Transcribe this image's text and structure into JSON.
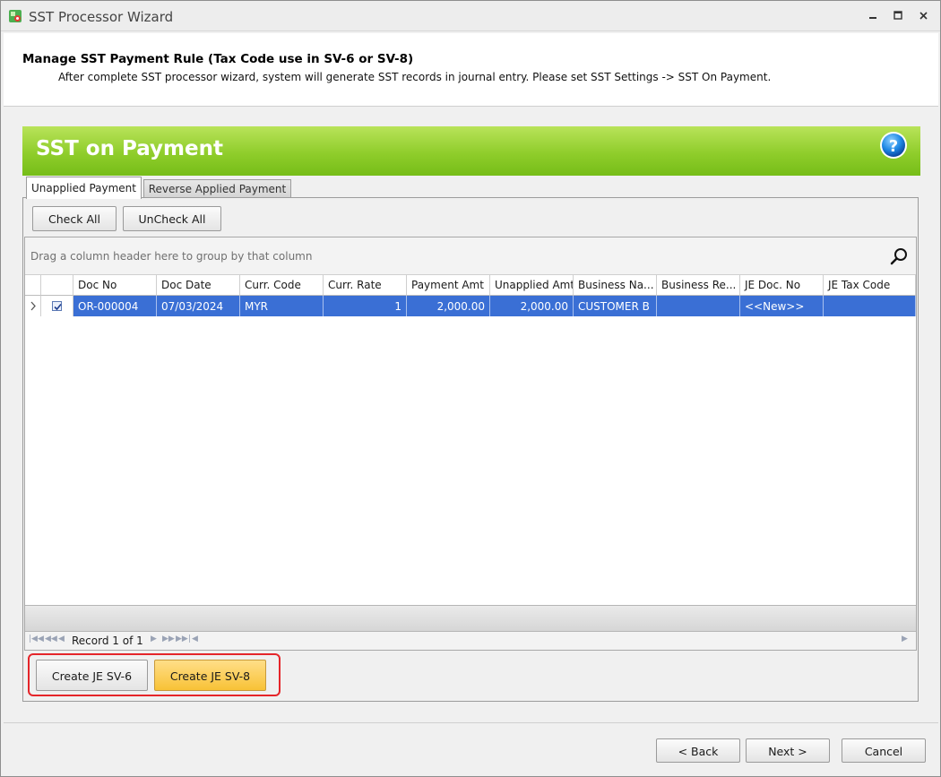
{
  "window": {
    "title": "SST Processor Wizard"
  },
  "header": {
    "title": "Manage SST Payment Rule (Tax Code use in SV-6 or SV-8)",
    "description": "After complete SST processor wizard, system will generate SST records in journal entry. Please set SST Settings -> SST On Payment."
  },
  "banner": {
    "title": "SST on Payment"
  },
  "tabs": [
    {
      "label": "Unapplied Payment",
      "active": true
    },
    {
      "label": "Reverse Applied Payment",
      "active": false
    }
  ],
  "toolbar": {
    "check_all": "Check All",
    "uncheck_all": "UnCheck All"
  },
  "grid": {
    "group_hint": "Drag a column header here to group by that column",
    "columns": [
      "Doc No",
      "Doc Date",
      "Curr. Code",
      "Curr. Rate",
      "Payment Amt",
      "Unapplied Amt",
      "Business Na...",
      "Business Re...",
      "JE Doc. No",
      "JE Tax Code"
    ],
    "rows": [
      {
        "checked": true,
        "cells": [
          "OR-000004",
          "07/03/2024",
          "MYR",
          "1",
          "2,000.00",
          "2,000.00",
          "CUSTOMER B",
          "",
          "<<New>>",
          ""
        ]
      }
    ],
    "navigator": "Record 1 of 1"
  },
  "actions": {
    "create_sv6": "Create JE SV-6",
    "create_sv8": "Create JE SV-8"
  },
  "wizard": {
    "back": "< Back",
    "next": "Next >",
    "cancel": "Cancel"
  },
  "colors": {
    "banner_green": "#8fcd2b",
    "selected_row": "#3a6fd5",
    "highlight_border": "#e5252a",
    "primary_button": "#f8c236"
  }
}
